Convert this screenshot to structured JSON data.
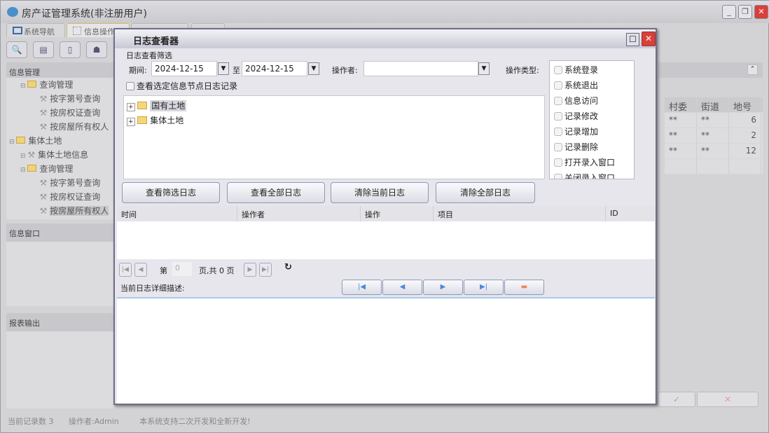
{
  "app": {
    "title": "房产证管理系统(非注册用户)",
    "tabs": [
      "系统导航",
      "信息操作"
    ]
  },
  "left": {
    "section_info": "信息管理",
    "section_window": "信息窗口",
    "section_report": "报表输出",
    "tree": [
      {
        "label": "查询管理",
        "level": 1,
        "icon": "folder-icon"
      },
      {
        "label": "按字第号查询",
        "level": 2,
        "icon": "tool-icon"
      },
      {
        "label": "按房权证查询",
        "level": 2,
        "icon": "tool-icon"
      },
      {
        "label": "按房屋所有权人",
        "level": 2,
        "icon": "tool-icon"
      },
      {
        "label": "集体土地",
        "level": 0,
        "icon": "folder-icon"
      },
      {
        "label": "集体土地信息",
        "level": 1,
        "icon": "tool-icon"
      },
      {
        "label": "查询管理",
        "level": 1,
        "icon": "folder-icon"
      },
      {
        "label": "按字第号查询",
        "level": 2,
        "icon": "tool-icon"
      },
      {
        "label": "按房权证查询",
        "level": 2,
        "icon": "tool-icon"
      },
      {
        "label": "按房屋所有权人",
        "level": 2,
        "icon": "tool-icon"
      }
    ]
  },
  "grid": {
    "columns": [
      "村委",
      "街道",
      "地号"
    ],
    "rows": [
      [
        "**",
        "**",
        "6"
      ],
      [
        "**",
        "**",
        "2"
      ],
      [
        "**",
        "**",
        "12"
      ]
    ]
  },
  "status": {
    "records": "当前记录数 3",
    "operator": "操作者:Admin",
    "note": "本系统支持二次开发和全新开发!"
  },
  "dialog": {
    "title": "日志查看器",
    "filter_label": "日志查看筛选",
    "period_label": "期间:",
    "date_from": "2024-12-15",
    "to_label": "至",
    "date_to": "2024-12-15",
    "operator_label": "操作者:",
    "operator_value": "",
    "optype_label": "操作类型:",
    "optypes": [
      "系统登录",
      "系统退出",
      "信息访问",
      "记录修改",
      "记录增加",
      "记录删除",
      "打开录入窗口",
      "关闭录入窗口"
    ],
    "node_check_label": "查看选定信息节点日志记录",
    "tree": [
      "国有土地",
      "集体土地"
    ],
    "buttons": [
      "查看筛选日志",
      "查看全部日志",
      "清除当前日志",
      "清除全部日志"
    ],
    "columns": [
      "时间",
      "操作者",
      "操作",
      "项目",
      "ID"
    ],
    "pager": {
      "prefix": "第",
      "page": "0",
      "suffix": "页,共 0 页"
    },
    "detail_label": "当前日志详细描述:",
    "detail_text": ""
  },
  "colors": {
    "close": "#d9403a",
    "accent": "#4a8ad8"
  }
}
